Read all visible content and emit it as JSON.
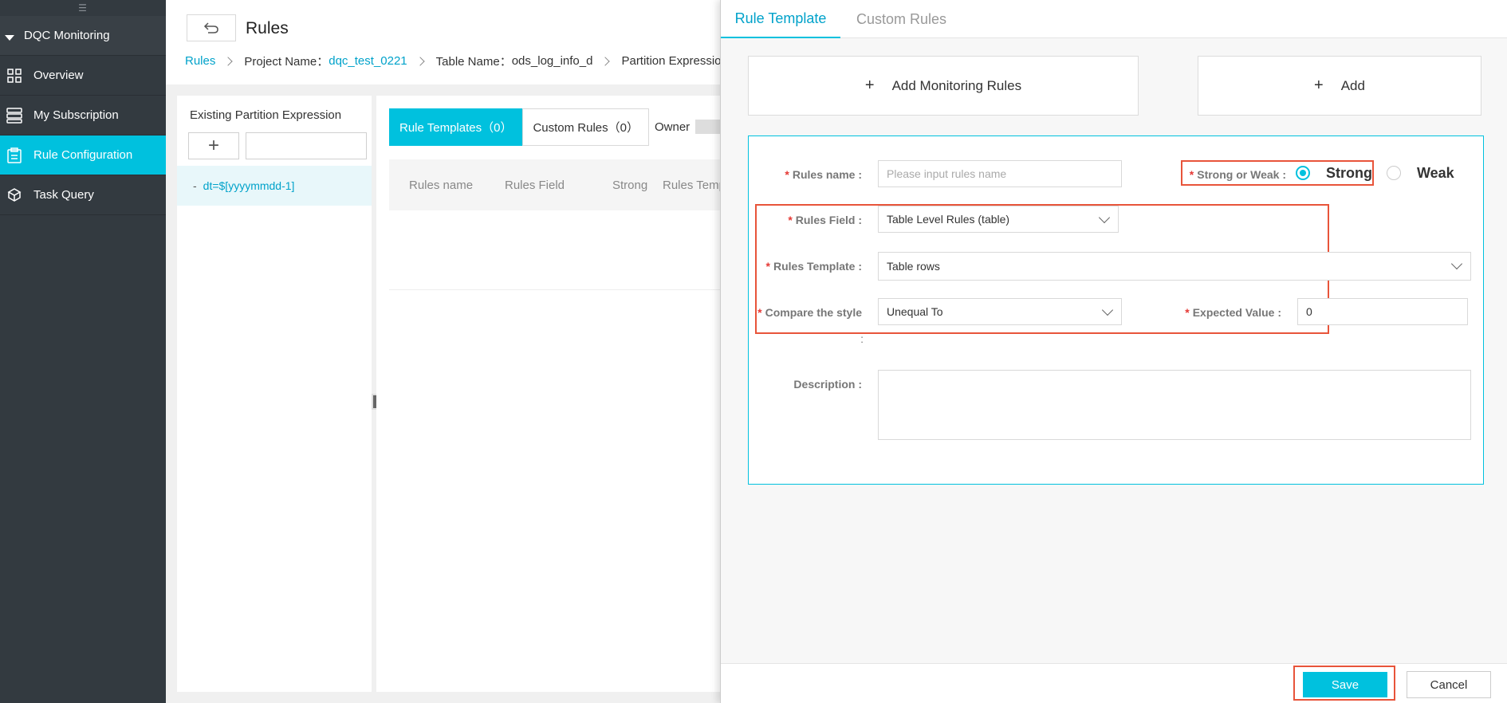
{
  "sidebar": {
    "group_label": "DQC Monitoring",
    "items": [
      {
        "label": "Overview"
      },
      {
        "label": "My Subscription"
      },
      {
        "label": "Rule Configuration"
      },
      {
        "label": "Task Query"
      }
    ]
  },
  "header": {
    "title": "Rules",
    "breadcrumb": {
      "root": "Rules",
      "project_label": "Project Name：",
      "project_value": "dqc_test_0221",
      "table_label": "Table Name：",
      "table_value": "ods_log_info_d",
      "partition_label": "Partition Expression"
    }
  },
  "left_panel": {
    "title": "Existing Partition Expression",
    "add_symbol": "+",
    "expression": "dt=$[yyyymmdd-1]"
  },
  "center_panel": {
    "tabs": [
      {
        "label": "Rule Templates（0）"
      },
      {
        "label": "Custom Rules（0）"
      }
    ],
    "owner_label": "Owner",
    "columns": [
      "Rules name",
      "Rules Field",
      "Strong",
      "Rules Temp"
    ]
  },
  "drawer": {
    "tabs": [
      {
        "label": "Rule Template"
      },
      {
        "label": "Custom Rules"
      }
    ],
    "add_monitoring_rules": "Add Monitoring Rules",
    "add": "Add",
    "plus": "+",
    "form": {
      "required_mark": "*",
      "rules_name_label": "Rules name :",
      "rules_name_placeholder": "Please input rules name",
      "strong_or_weak_label": "Strong or Weak :",
      "strong_option": "Strong",
      "weak_option": "Weak",
      "rules_field_label": "Rules Field :",
      "rules_field_value": "Table Level Rules (table)",
      "rules_template_label": "Rules Template :",
      "rules_template_value": "Table rows",
      "compare_style_label": "Compare the style",
      "compare_style_colon": ":",
      "compare_style_value": "Unequal To",
      "expected_value_label": "Expected Value :",
      "expected_value": "0",
      "description_label": "Description :"
    },
    "save_label": "Save",
    "cancel_label": "Cancel"
  },
  "colors": {
    "accent": "#00c1de",
    "link": "#00a2ca",
    "sidebar_bg": "#333a40",
    "highlight": "#e8543a"
  }
}
